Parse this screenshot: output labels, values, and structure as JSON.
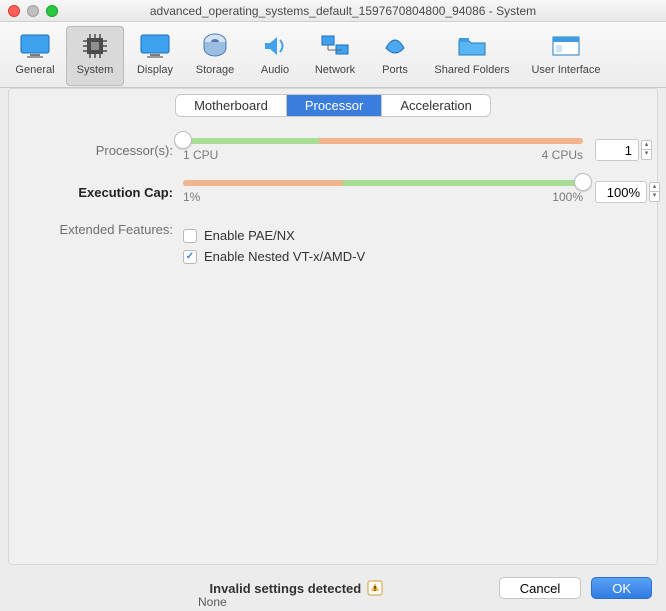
{
  "window": {
    "title": "advanced_operating_systems_default_1597670804800_94086 - System"
  },
  "toolbar": {
    "items": [
      {
        "label": "General"
      },
      {
        "label": "System"
      },
      {
        "label": "Display"
      },
      {
        "label": "Storage"
      },
      {
        "label": "Audio"
      },
      {
        "label": "Network"
      },
      {
        "label": "Ports"
      },
      {
        "label": "Shared Folders"
      },
      {
        "label": "User Interface"
      }
    ],
    "selected_index": 1
  },
  "tabs": {
    "items": [
      "Motherboard",
      "Processor",
      "Acceleration"
    ],
    "selected_index": 1
  },
  "processor": {
    "label": "Processor(s):",
    "value": "1",
    "scale_min": "1 CPU",
    "scale_max": "4 CPUs",
    "green_pct": 34,
    "orange_start_pct": 34,
    "orange_end_pct": 100,
    "knob_pct": 0
  },
  "exec_cap": {
    "label": "Execution Cap:",
    "value": "100%",
    "scale_min": "1%",
    "scale_max": "100%",
    "gray_end_pct": 40,
    "green_start_pct": 40,
    "knob_pct": 100
  },
  "extended": {
    "label": "Extended Features:",
    "pae": {
      "label": "Enable PAE/NX",
      "checked": false
    },
    "nested": {
      "label": "Enable Nested VT-x/AMD-V",
      "checked": true
    }
  },
  "footer": {
    "message": "Invalid settings detected",
    "cancel": "Cancel",
    "ok": "OK",
    "ghost": "None"
  }
}
